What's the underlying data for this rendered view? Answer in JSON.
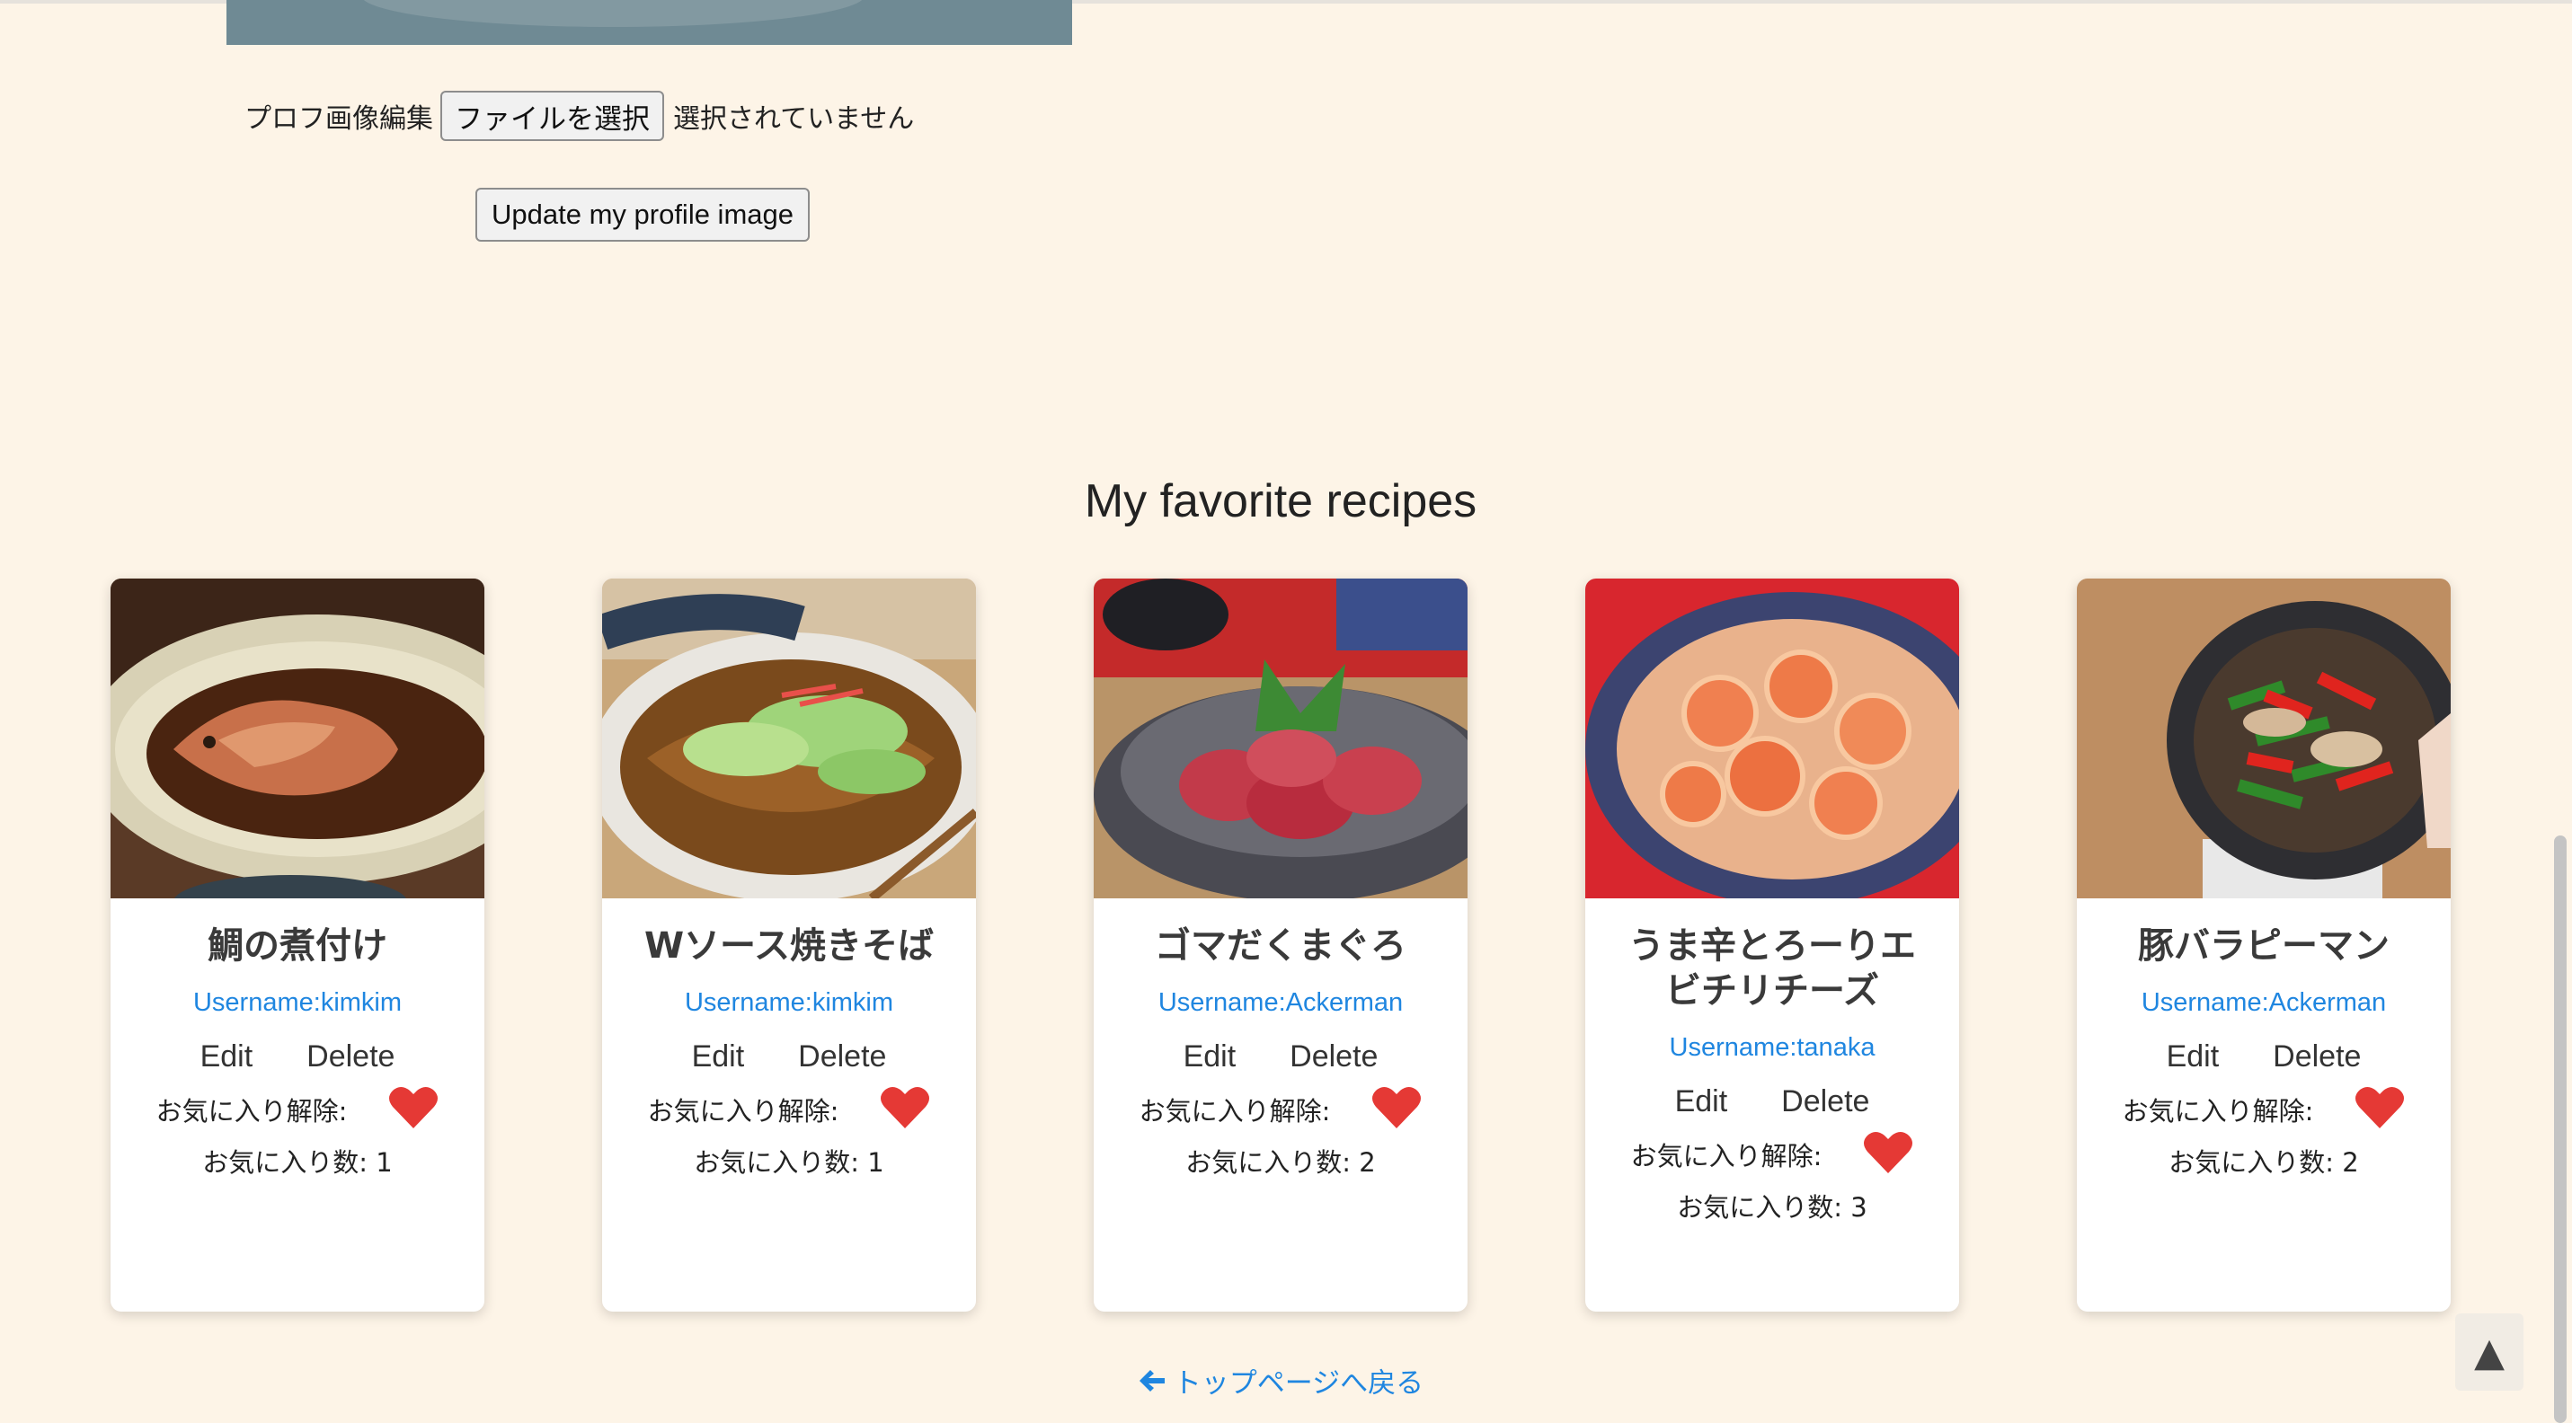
{
  "profile": {
    "edit_label": "プロフ画像編集",
    "file_button_label": "ファイルを選択",
    "file_status": "選択されていません",
    "update_button_label": "Update my profile image"
  },
  "section_title": "My favorite recipes",
  "recipes": [
    {
      "title": "鯛の煮付け",
      "username": "Username:kimkim",
      "edit_label": "Edit",
      "delete_label": "Delete",
      "fav_label": "お気に入り解除:",
      "fav_count_text": "お気に入り数: 1"
    },
    {
      "title": "Wソース焼きそば",
      "username": "Username:kimkim",
      "edit_label": "Edit",
      "delete_label": "Delete",
      "fav_label": "お気に入り解除:",
      "fav_count_text": "お気に入り数: 1"
    },
    {
      "title": "ゴマだくまぐろ",
      "username": "Username:Ackerman",
      "edit_label": "Edit",
      "delete_label": "Delete",
      "fav_label": "お気に入り解除:",
      "fav_count_text": "お気に入り数: 2"
    },
    {
      "title": "うま辛とろーりエビチリチーズ",
      "username": "Username:tanaka",
      "edit_label": "Edit",
      "delete_label": "Delete",
      "fav_label": "お気に入り解除:",
      "fav_count_text": "お気に入り数: 3"
    },
    {
      "title": "豚バラピーマン",
      "username": "Username:Ackerman",
      "edit_label": "Edit",
      "delete_label": "Delete",
      "fav_label": "お気に入り解除:",
      "fav_count_text": "お気に入り数: 2"
    }
  ],
  "back_link_label": "トップページへ戻る",
  "scroll_top_glyph": "▲",
  "colors": {
    "background": "#fdf4e7",
    "link": "#1f86e0",
    "heart": "#e53935"
  },
  "icons": {
    "back": "arrow-left-icon",
    "favorite": "heart-icon",
    "scroll_top": "triangle-up-icon"
  }
}
